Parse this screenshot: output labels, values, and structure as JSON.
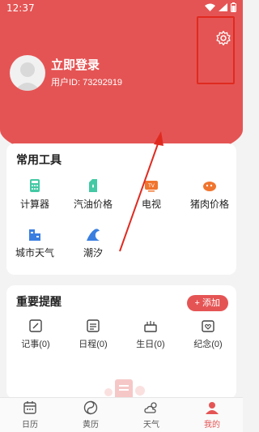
{
  "status": {
    "time": "12:37"
  },
  "profile": {
    "login_label": "立即登录",
    "user_id": "用户ID: 73292919"
  },
  "tools": {
    "title": "常用工具",
    "items": [
      {
        "label": "计算器",
        "icon": "calculator-icon"
      },
      {
        "label": "汽油价格",
        "icon": "gas-price-icon"
      },
      {
        "label": "电视",
        "icon": "tv-icon"
      },
      {
        "label": "猪肉价格",
        "icon": "pork-price-icon"
      },
      {
        "label": "城市天气",
        "icon": "city-weather-icon"
      },
      {
        "label": "潮汐",
        "icon": "tide-icon"
      }
    ]
  },
  "reminders": {
    "title": "重要提醒",
    "add_label": "+ 添加",
    "items": [
      {
        "label": "记事(0)",
        "icon": "note-icon"
      },
      {
        "label": "日程(0)",
        "icon": "schedule-icon"
      },
      {
        "label": "生日(0)",
        "icon": "birthday-cake-icon"
      },
      {
        "label": "纪念(0)",
        "icon": "anniversary-icon"
      }
    ]
  },
  "tabs": [
    {
      "label": "日历",
      "icon": "calendar-icon",
      "active": false
    },
    {
      "label": "黄历",
      "icon": "yin-yang-icon",
      "active": false
    },
    {
      "label": "天气",
      "icon": "weather-icon",
      "active": false
    },
    {
      "label": "我的",
      "icon": "user-icon",
      "active": true
    }
  ],
  "colors": {
    "brand": "#e55454",
    "highlight": "#e02a20"
  }
}
